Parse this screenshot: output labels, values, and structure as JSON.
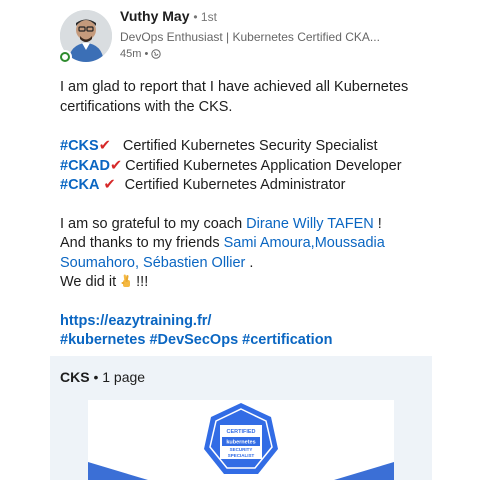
{
  "author": {
    "name": "Vuthy May",
    "degree": "• 1st",
    "headline": "DevOps Enthusiast | Kubernetes Certified CKA...",
    "time": "45m •"
  },
  "post": {
    "intro": "I am glad to report that I have achieved all Kubernetes certifications with the CKS.",
    "certs": [
      {
        "tag": "#CKS",
        "check": "✔",
        "desc": "Certified Kubernetes Security Specialist"
      },
      {
        "tag": "#CKAD",
        "check": "✔",
        "desc": "Certified Kubernetes Application Developer"
      },
      {
        "tag": "#CKA",
        "check": "✔",
        "desc": "Certified Kubernetes Administrator"
      }
    ],
    "thanks_prefix": "I am so grateful to my coach ",
    "coach": "Dirane Willy TAFEN",
    "thanks_suffix": " !",
    "friends_prefix": "And thanks to my friends ",
    "friend1": "Sami Amoura",
    "comma": ",",
    "friend2": "Moussadia Soumahoro",
    "sep": ", ",
    "friend3": "Sébastien Ollier",
    "period": " .",
    "did_it": "We did it",
    "exclaim": "!!!",
    "url": "https://eazytraining.fr/",
    "hashtags": [
      "#kubernetes",
      "#DevSecOps",
      "#certification"
    ]
  },
  "document": {
    "title": "CKS",
    "pages": "• 1 page",
    "badge_lines": [
      "CERTIFIED",
      "kubernetes",
      "SECURITY",
      "SPECIALIST"
    ]
  },
  "colors": {
    "link": "#0a66c2",
    "check": "#d62828",
    "badge": "#326ce5",
    "doc_bg": "#eef3f8"
  }
}
